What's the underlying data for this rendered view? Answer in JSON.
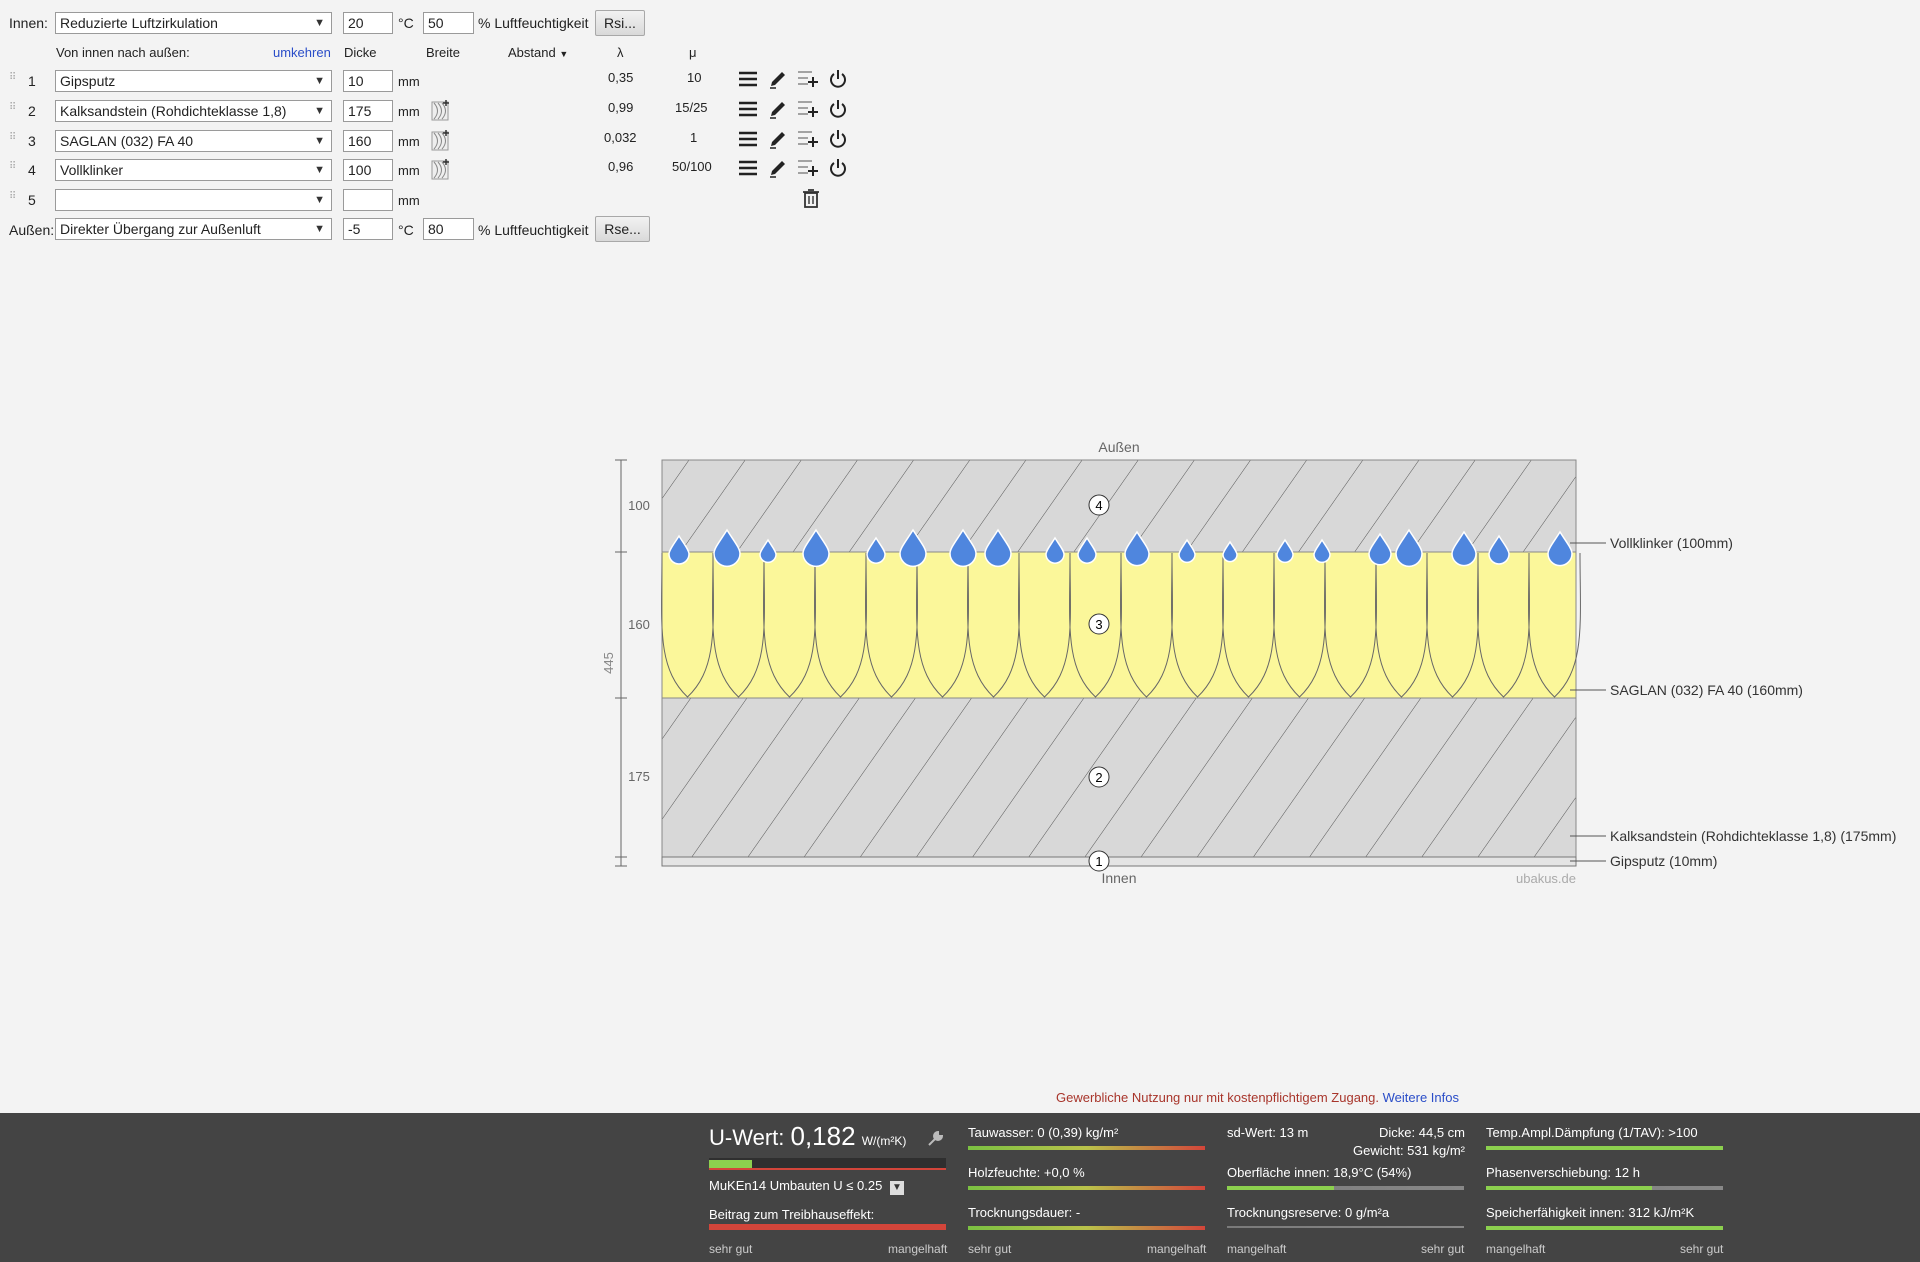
{
  "header": {
    "inside_label": "Innen:",
    "inside_condition": "Reduzierte Luftzirkulation",
    "inside_temp": "20",
    "celsius": "°C",
    "inside_humidity": "50",
    "humidity_label": "% Luftfeuchtigkeit",
    "rsi_button": "Rsi...",
    "direction_label": "Von innen nach außen:",
    "reverse_link": "umkehren",
    "col_thickness": "Dicke",
    "col_width": "Breite",
    "col_distance": "Abstand",
    "col_lambda": "λ",
    "col_mu": "μ",
    "outside_label": "Außen:",
    "outside_condition": "Direkter Übergang zur Außenluft",
    "outside_temp": "-5",
    "outside_humidity": "80",
    "rse_button": "Rse..."
  },
  "layers": [
    {
      "num": "1",
      "material": "Gipsputz",
      "thickness": "10",
      "unit": "mm",
      "lambda": "0,35",
      "mu": "10"
    },
    {
      "num": "2",
      "material": "Kalksandstein (Rohdichteklasse 1,8)",
      "thickness": "175",
      "unit": "mm",
      "lambda": "0,99",
      "mu": "15/25"
    },
    {
      "num": "3",
      "material": "SAGLAN (032) FA 40",
      "thickness": "160",
      "unit": "mm",
      "lambda": "0,032",
      "mu": "1"
    },
    {
      "num": "4",
      "material": "Vollklinker",
      "thickness": "100",
      "unit": "mm",
      "lambda": "0,96",
      "mu": "50/100"
    },
    {
      "num": "5",
      "material": "",
      "thickness": "",
      "unit": "mm",
      "lambda": "",
      "mu": ""
    }
  ],
  "diagram": {
    "outside_label": "Außen",
    "inside_label": "Innen",
    "watermark": "ubakus.de",
    "total": "445",
    "dim_labels": [
      "100",
      "160",
      "175"
    ],
    "layer_markers": [
      "4",
      "3",
      "2",
      "1"
    ],
    "callouts": [
      "Vollklinker (100mm)",
      "SAGLAN (032) FA 40 (160mm)",
      "Kalksandstein (Rohdichteklasse 1,8) (175mm)",
      "Gipsputz (10mm)"
    ]
  },
  "notice": {
    "text": "Gewerbliche Nutzung nur mit kostenpflichtigem Zugang.",
    "link": "Weitere Infos"
  },
  "footer": {
    "u_label": "U-Wert:",
    "u_value": "0,182",
    "u_unit": "W/(m²K)",
    "u_level": 0.18,
    "muken": "MuKEn14 Umbauten U ≤ 0.25",
    "greenhouse": "Beitrag zum Treibhauseffekt:",
    "good": "sehr gut",
    "poor": "mangelhaft",
    "condensate": "Tauwasser: 0 (0,39) kg/m²",
    "wood_moisture": "Holzfeuchte: +0,0 %",
    "drying": "Trocknungsdauer: -",
    "sd": "sd-Wert: 13 m",
    "thickness": "Dicke: 44,5 cm",
    "weight": "Gewicht: 531 kg/m²",
    "surface": "Oberfläche innen: 18,9°C (54%)",
    "surface_level": 0.45,
    "drying_reserve": "Trocknungsreserve: 0 g/m²a",
    "temp_ampl": "Temp.Ampl.Dämpfung (1/TAV): >100",
    "temp_level": 1.0,
    "phase": "Phasenverschiebung: 12 h",
    "phase_level": 0.7,
    "storage": "Speicherfähigkeit innen: 312 kJ/m²K",
    "storage_level": 1.0,
    "poor2": "mangelhaft",
    "good2": "sehr gut"
  }
}
